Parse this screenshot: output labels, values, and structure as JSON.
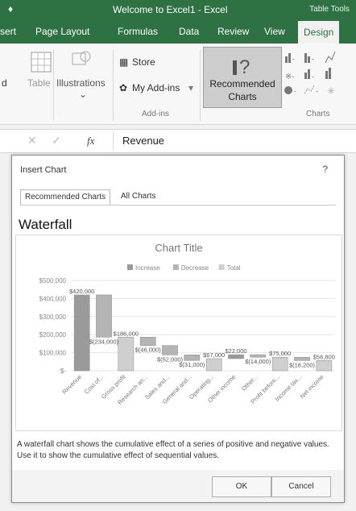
{
  "window": {
    "title": "Welcome to Excel1 - Excel",
    "context_tools": "Table Tools",
    "quick_access": "♦"
  },
  "ribbon_tabs": [
    {
      "label": "sert"
    },
    {
      "label": "Page Layout"
    },
    {
      "label": "Formulas"
    },
    {
      "label": "Data"
    },
    {
      "label": "Review"
    },
    {
      "label": "View"
    },
    {
      "label": "Design"
    }
  ],
  "ribbon": {
    "table_label": "Table",
    "d_label": "d",
    "illustrations_label": "Illustrations",
    "store_label": "Store",
    "my_addins_label": "My Add-ins",
    "addins_group_label": "Add-ins",
    "recommended_line1": "Recommended",
    "recommended_line2": "Charts",
    "charts_group_label": "Charts"
  },
  "formula_bar": {
    "fx_label": "fx",
    "value": "Revenue"
  },
  "dialog": {
    "title": "Insert Chart",
    "help": "?",
    "tabs": [
      "Recommended Charts",
      "All Charts"
    ],
    "chart_type_name": "Waterfall",
    "description": "A waterfall chart shows the cumulative effect of a series of positive and negative values. Use it to show the cumulative effect of sequential values.",
    "ok_label": "OK",
    "cancel_label": "Cancel"
  },
  "colors": {
    "excel_green": "#2e7244",
    "series_gray": "#a5a5a5"
  },
  "chart_data": {
    "type": "bar",
    "subtype": "waterfall",
    "title": "Chart Title",
    "legend": [
      "Increase",
      "Decrease",
      "Total"
    ],
    "legend_position": "top",
    "categories": [
      "Revenue",
      "Cost of...",
      "Gross profit",
      "Research an...",
      "Sales and...",
      "General and...",
      "Operating...",
      "Other income",
      "Other...",
      "Profit before...",
      "Income tax...",
      "Net income"
    ],
    "values": [
      420000,
      -234000,
      186000,
      -46000,
      -52000,
      -31000,
      67000,
      22000,
      -14000,
      75000,
      -18200,
      56800
    ],
    "kinds": [
      "increase",
      "decrease",
      "total",
      "decrease",
      "decrease",
      "decrease",
      "total",
      "increase",
      "decrease",
      "total",
      "decrease",
      "total"
    ],
    "data_labels": [
      "$420,000",
      "$(234,000)",
      "$186,000",
      "$(46,000)",
      "$(52,000)",
      "$(31,000)",
      "$67,000",
      "$22,000",
      "$(14,000)",
      "$75,000",
      "$(18,200)",
      "$56,800"
    ],
    "y_ticks": [
      "$-",
      "$100,000",
      "$200,000",
      "$300,000",
      "$400,000",
      "$500,000"
    ],
    "ylim": [
      0,
      500000
    ],
    "grid": true
  }
}
